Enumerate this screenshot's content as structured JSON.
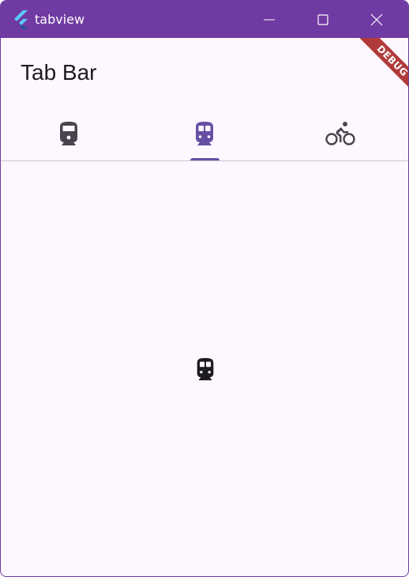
{
  "window": {
    "title": "tabview"
  },
  "app_bar": {
    "title": "Tab Bar"
  },
  "tabs": [
    {
      "icon": "train-icon",
      "selected": false
    },
    {
      "icon": "subway-icon",
      "selected": true
    },
    {
      "icon": "bike-icon",
      "selected": false
    }
  ],
  "content": {
    "icon": "subway-icon"
  },
  "debug_banner": {
    "label": "DEBUG"
  },
  "colors": {
    "titlebar": "#6f3aa2",
    "surface": "#fdf7ff",
    "primary": "#6750a4",
    "icon_default": "#49454f",
    "icon_dark": "#1d1b20",
    "debug": "#b13b3b"
  }
}
